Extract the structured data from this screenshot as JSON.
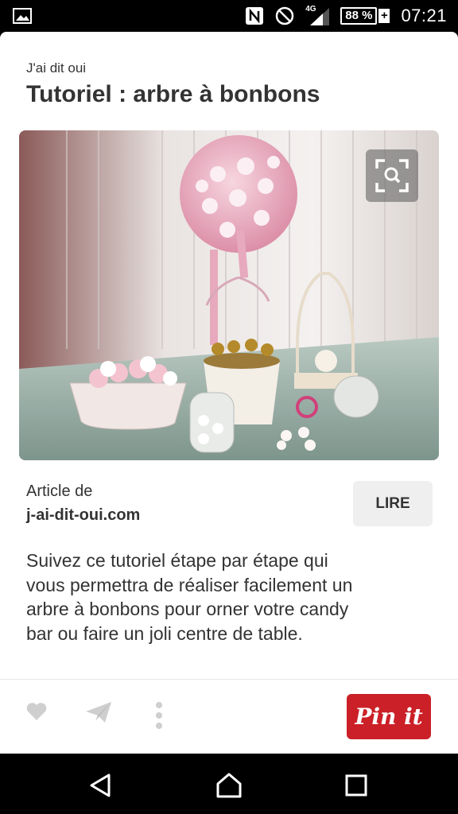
{
  "status_bar": {
    "battery": "88 %",
    "battery_charging": "+",
    "network": "4G",
    "time": "07:21"
  },
  "pin": {
    "source_name": "J'ai dit oui",
    "title": "Tutoriel : arbre à bonbons",
    "article_label": "Article de",
    "article_domain": "j-ai-dit-oui.com",
    "read_button": "LIRE",
    "description": "Suivez ce tutoriel étape par étape qui vous permettra de réaliser facilement un arbre à bonbons pour orner votre candy bar ou faire un joli centre de table."
  },
  "actions": {
    "pinit_label": "Pin it"
  },
  "colors": {
    "accent": "#cb2027",
    "text": "#333333"
  }
}
